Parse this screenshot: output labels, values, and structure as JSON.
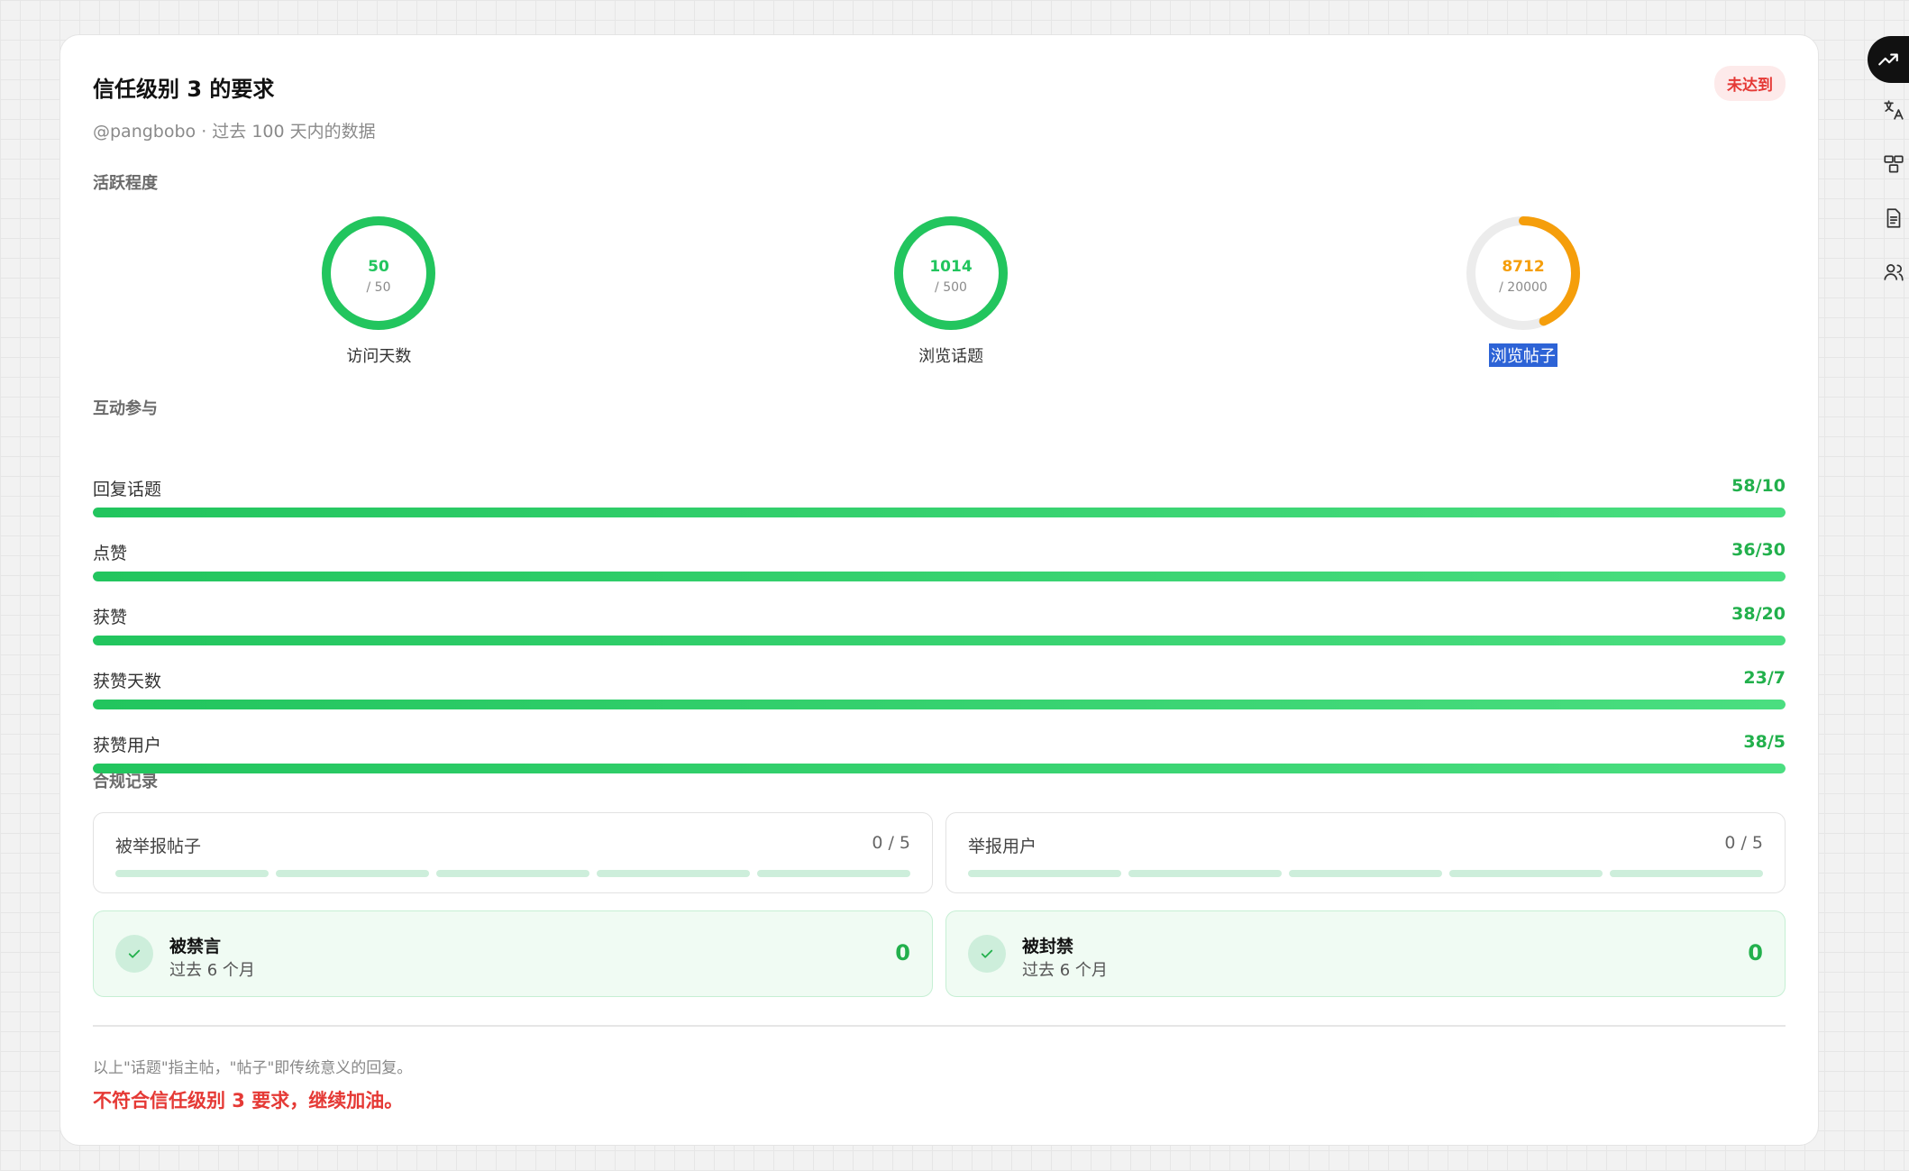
{
  "header": {
    "title": "信任级别 3 的要求",
    "status_badge": "未达到",
    "subtitle": "@pangbobo · 过去 100 天内的数据"
  },
  "activity": {
    "section_label": "活跃程度",
    "rings": [
      {
        "value": "50",
        "target": "/ 50",
        "label": "访问天数",
        "progress": 1.0,
        "color": "#22c55e"
      },
      {
        "value": "1014",
        "target": "/ 500",
        "label": "浏览话题",
        "progress": 1.0,
        "color": "#22c55e"
      },
      {
        "value": "8712",
        "target": "/ 20000",
        "label": "浏览帖子",
        "progress": 0.4356,
        "color": "#f59e0b"
      }
    ]
  },
  "interaction": {
    "section_label": "互动参与",
    "bars": [
      {
        "label": "回复话题",
        "value": "58/10",
        "progress": 1.0
      },
      {
        "label": "点赞",
        "value": "36/30",
        "progress": 1.0
      },
      {
        "label": "获赞",
        "value": "38/20",
        "progress": 1.0
      },
      {
        "label": "获赞天数",
        "value": "23/7",
        "progress": 1.0
      },
      {
        "label": "获赞用户",
        "value": "38/5",
        "progress": 1.0
      }
    ]
  },
  "compliance": {
    "section_label": "合规记录",
    "reports": [
      {
        "label": "被举报帖子",
        "value": "0 / 5",
        "segments": 5
      },
      {
        "label": "举报用户",
        "value": "0 / 5",
        "segments": 5
      }
    ],
    "penalties": [
      {
        "label": "被禁言",
        "period": "过去 6 个月",
        "value": "0"
      },
      {
        "label": "被封禁",
        "period": "过去 6 个月",
        "value": "0"
      }
    ]
  },
  "footer": {
    "note": "以上\"话题\"指主帖，\"帖子\"即传统意义的回复。",
    "verdict": "不符合信任级别 3 要求，继续加油。"
  },
  "sidebar_icons": [
    "trending-up-icon",
    "translate-icon",
    "layout-icon",
    "document-icon",
    "users-icon"
  ]
}
